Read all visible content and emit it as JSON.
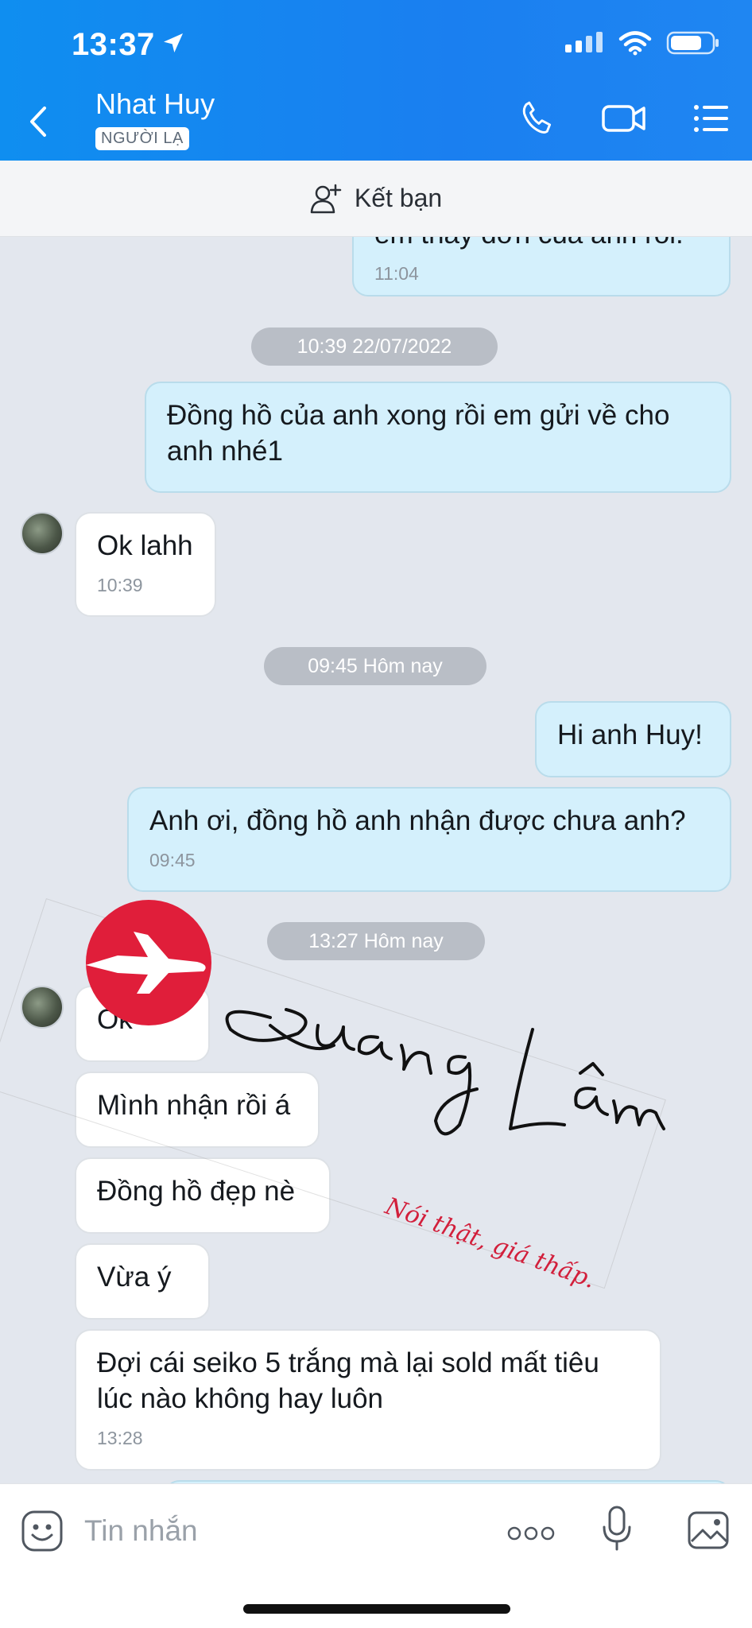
{
  "status_bar": {
    "time": "13:37"
  },
  "header": {
    "contact_name": "Nhat Huy",
    "badge": "NGƯỜI LẠ"
  },
  "add_friend": {
    "label": "Kết bạn"
  },
  "messages": [
    {
      "side": "mine",
      "text": "em thấy  đơn của anh rồi.",
      "time": "11:04"
    },
    {
      "type": "divider",
      "text": "10:39 22/07/2022"
    },
    {
      "side": "mine",
      "text": "Đồng hồ của anh xong rồi em gửi về cho anh nhé1"
    },
    {
      "side": "theirs",
      "text": "Ok lahh",
      "time": "10:39"
    },
    {
      "type": "divider",
      "text": "09:45 Hôm nay"
    },
    {
      "side": "mine",
      "text": "Hi anh Huy!"
    },
    {
      "side": "mine",
      "text": "Anh ơi, đồng hồ anh nhận được chưa anh?",
      "time": "09:45"
    },
    {
      "type": "divider",
      "text": "13:27 Hôm nay"
    },
    {
      "side": "theirs",
      "text": "Ok"
    },
    {
      "side": "theirs",
      "text": "Mình nhận rồi á"
    },
    {
      "side": "theirs",
      "text": "Đồng hồ đẹp nè"
    },
    {
      "side": "theirs",
      "text": "Vừa ý"
    },
    {
      "side": "theirs",
      "text": "Đợi cái seiko 5 trắng mà lại sold mất tiêu lúc nào không hay luôn",
      "time": "13:28"
    }
  ],
  "watermark": {
    "signature": "Quang Lâm",
    "tagline": "Nói thật, giá thấp."
  },
  "input": {
    "placeholder": "Tin nhắn"
  },
  "colors": {
    "header_blue": "#1a7ff0",
    "my_bubble": "#d4f0fc",
    "their_bubble": "#ffffff",
    "watermark_red": "#e01e3a"
  }
}
